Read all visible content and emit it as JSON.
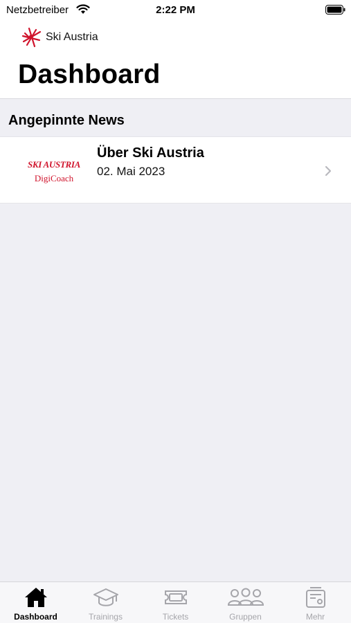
{
  "status_bar": {
    "carrier": "Netzbetreiber",
    "time": "2:22 PM"
  },
  "header": {
    "brand_name": "Ski Austria",
    "title": "Dashboard"
  },
  "pinned_news": {
    "section_title": "Angepinnte News",
    "items": [
      {
        "thumb_brand": "SKI AUSTRIA",
        "thumb_sub": "DigiCoach",
        "title": "Über Ski Austria",
        "date": "02. Mai 2023"
      }
    ]
  },
  "tab_bar": {
    "tabs": [
      {
        "label": "Dashboard",
        "icon": "house-icon",
        "active": true
      },
      {
        "label": "Trainings",
        "icon": "graduation-cap-icon",
        "active": false
      },
      {
        "label": "Tickets",
        "icon": "ticket-icon",
        "active": false
      },
      {
        "label": "Gruppen",
        "icon": "people-icon",
        "active": false
      },
      {
        "label": "Mehr",
        "icon": "id-card-icon",
        "active": false
      }
    ]
  },
  "colors": {
    "brand_red": "#d0142c",
    "background": "#efeff4",
    "inactive_tab": "#a5a5aa"
  }
}
